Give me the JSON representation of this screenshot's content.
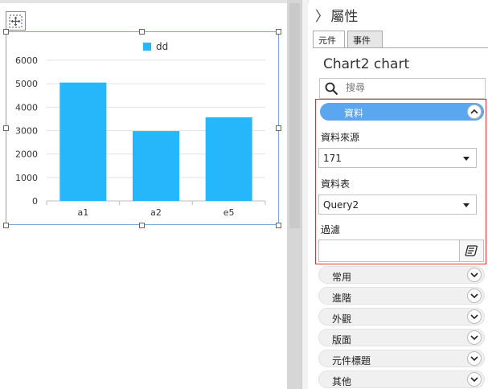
{
  "panel": {
    "title": "屬性",
    "tabs": [
      "元件",
      "事件"
    ],
    "component_title": "Chart2 chart",
    "search_placeholder": "搜尋"
  },
  "data_group": {
    "label": "資料",
    "source_label": "資料來源",
    "source_value": "171",
    "table_label": "資料表",
    "table_value": "Query2",
    "filter_label": "過濾",
    "filter_value": ""
  },
  "sections": [
    "常用",
    "進階",
    "外觀",
    "版面",
    "元件標題",
    "其他"
  ],
  "colors": {
    "bar": "#26b7fb",
    "accent": "#5aa7ef",
    "highlight_border": "#e0303a"
  },
  "chart_data": {
    "type": "bar",
    "categories": [
      "a1",
      "a2",
      "e5"
    ],
    "series": [
      {
        "name": "dd",
        "values": [
          5050,
          2980,
          3570
        ]
      }
    ],
    "ylim": [
      0,
      6000
    ],
    "yticks": [
      0,
      1000,
      2000,
      3000,
      4000,
      5000,
      6000
    ],
    "grid": true,
    "legend": "top"
  }
}
